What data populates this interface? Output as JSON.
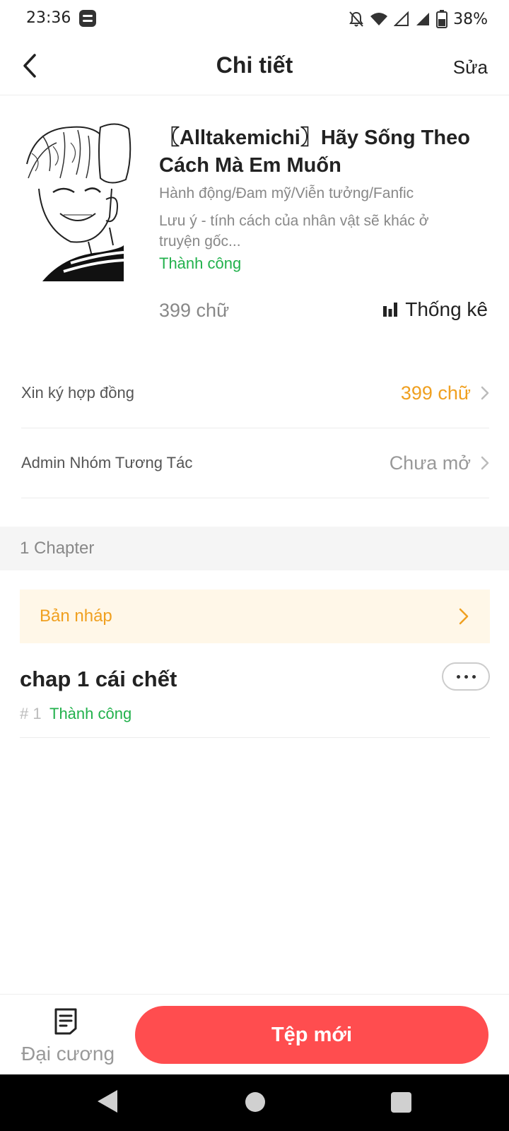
{
  "status_bar": {
    "time": "23:36",
    "battery_percent": "38%",
    "icons": [
      "app-notification-icon",
      "notifications-off-icon",
      "wifi-icon",
      "signal-icon",
      "signal-full-icon",
      "battery-icon"
    ]
  },
  "header": {
    "title": "Chi tiết",
    "edit_label": "Sửa"
  },
  "book": {
    "title": "〖Alltakemichi〗Hãy Sống Theo Cách Mà Em Muốn",
    "tags": "Hành động/Đam mỹ/Viễn tưởng/Fanfic",
    "description": "Lưu ý - tính cách của nhân vật sẽ khác ở truyện gốc...",
    "status": "Thành công",
    "word_count": "399 chữ",
    "stats_label": "Thống kê"
  },
  "settings": {
    "contract": {
      "label": "Xin ký hợp đồng",
      "value": "399 chữ",
      "value_color": "#f0a020"
    },
    "admin": {
      "label": "Admin Nhóm Tương Tác",
      "value": "Chưa mở",
      "value_color": "#999999"
    }
  },
  "chapters": {
    "count_label": "1 Chapter",
    "draft_label": "Bản nháp",
    "items": [
      {
        "title": "chap 1 cái chết",
        "number": "# 1",
        "status": "Thành công"
      }
    ]
  },
  "bottom_bar": {
    "outline_label": "Đại cương",
    "new_file_label": "Tệp mới"
  },
  "colors": {
    "accent_red": "#ff4d4f",
    "success_green": "#22b14c",
    "draft_orange": "#f0a020"
  }
}
